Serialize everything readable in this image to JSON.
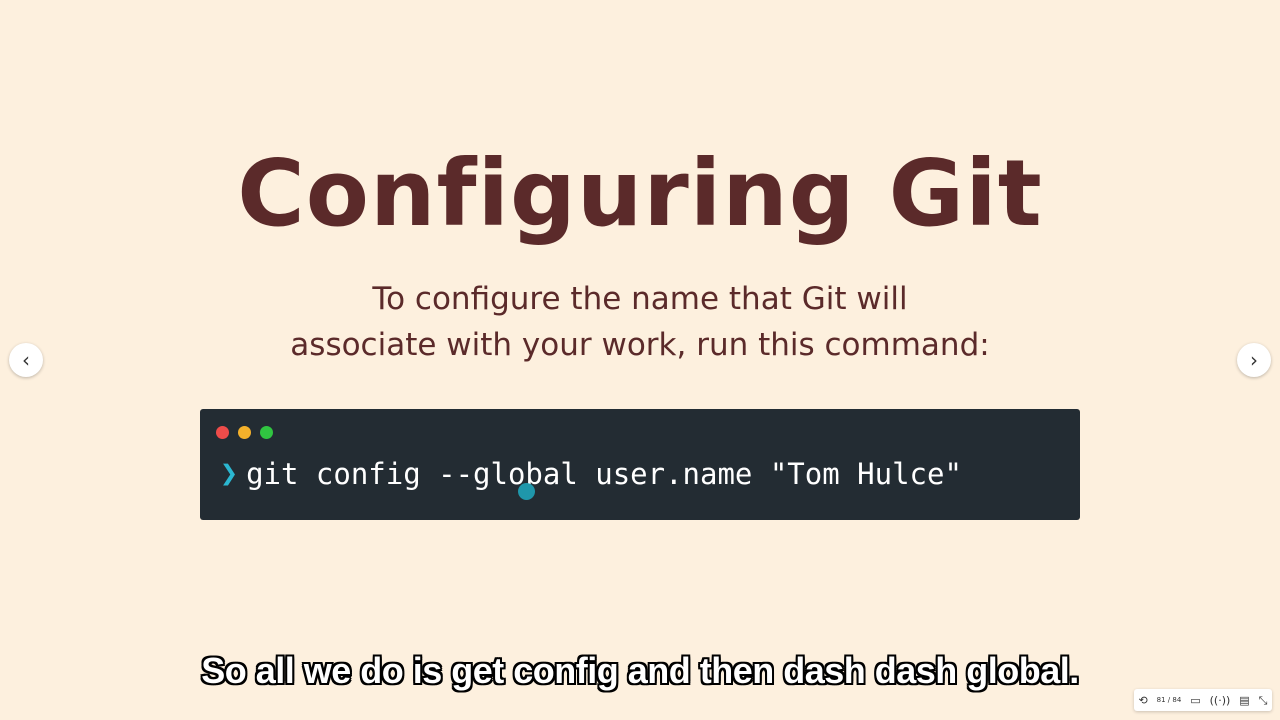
{
  "slide": {
    "title": "Configuring Git",
    "subtitle_line1": "To configure the name that Git will",
    "subtitle_line2": "associate with your work, run this command:",
    "terminal": {
      "prompt_symbol": "❯",
      "command": "git config --global user.name \"Tom Hulce\""
    }
  },
  "navigation": {
    "prev_icon": "chevron-left-icon",
    "next_icon": "chevron-right-icon",
    "prev_symbol": "‹",
    "next_symbol": "›"
  },
  "caption": "So all we do is get config and then dash dash global.",
  "toolbar": {
    "page_indicator": "81 / 84",
    "icons": [
      "rotate-icon",
      "window-icon",
      "broadcast-icon",
      "caption-icon",
      "collapse-icon"
    ]
  },
  "colors": {
    "background": "#fdf0de",
    "title": "#5b2a2a",
    "terminal_bg": "#232c33",
    "prompt": "#2bb7d1"
  }
}
